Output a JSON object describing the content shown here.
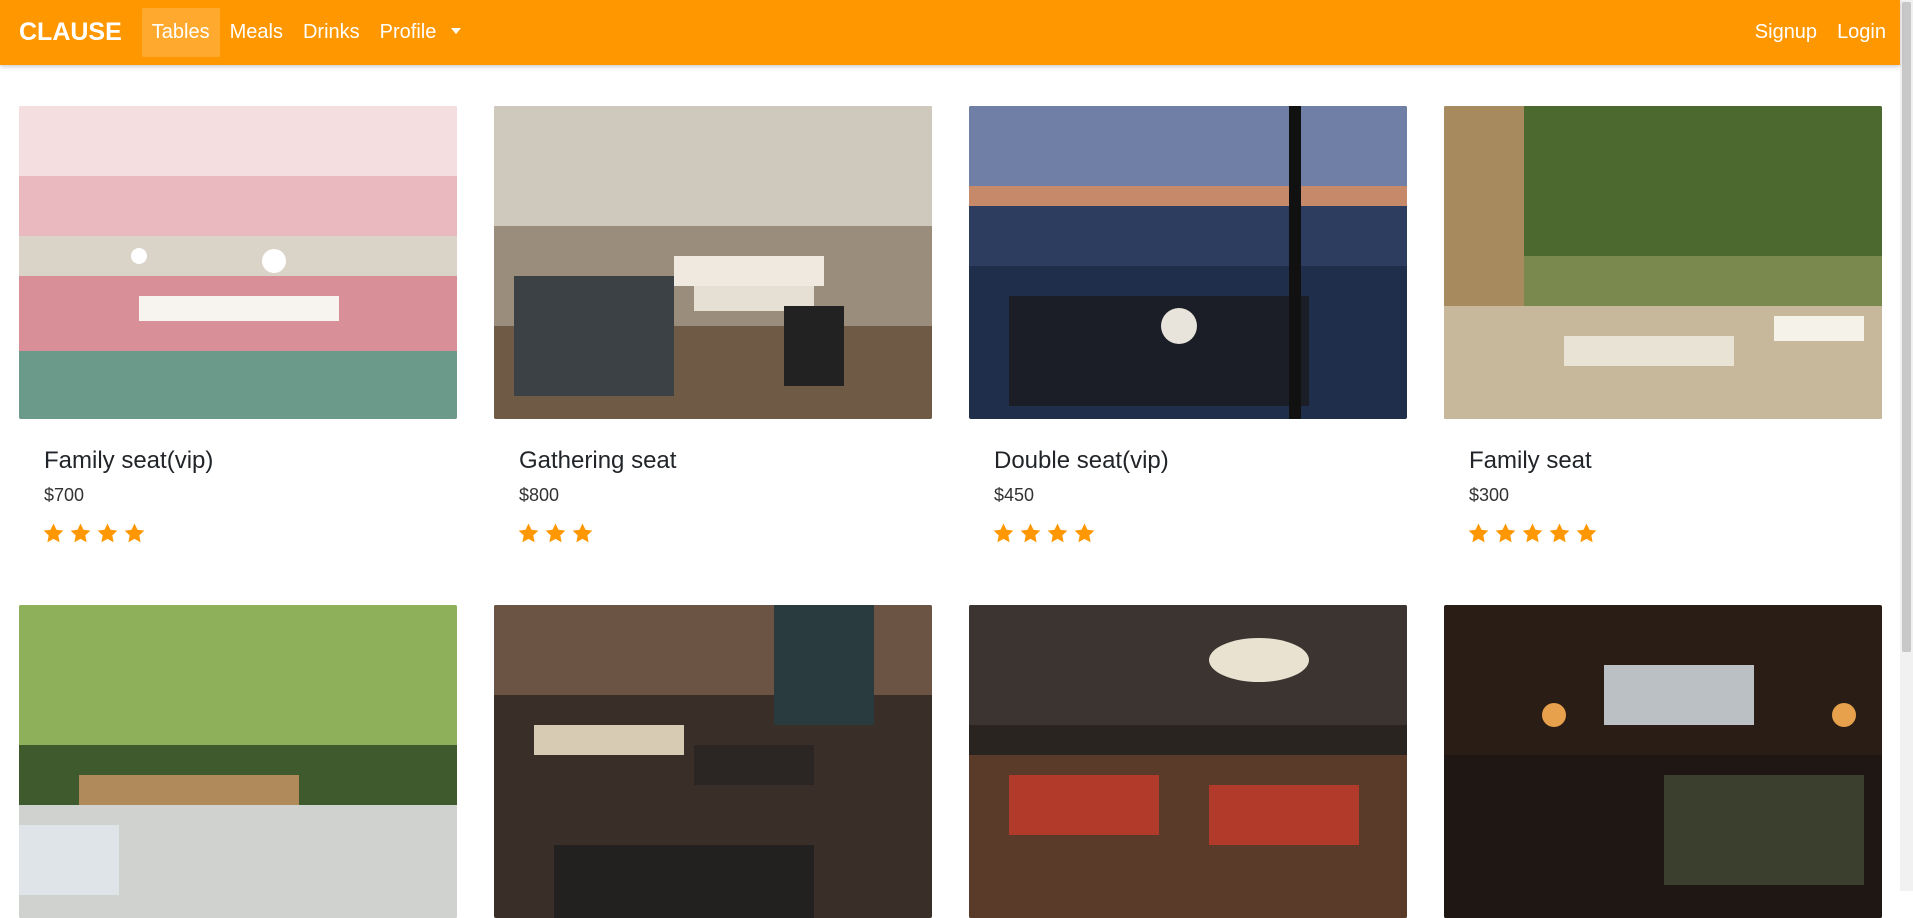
{
  "brand": "CLAUSE",
  "nav": {
    "items": [
      "Tables",
      "Meals",
      "Drinks",
      "Profile"
    ],
    "signup": "Signup",
    "login": "Login"
  },
  "colors": {
    "accent": "#ff9800",
    "star": "#ff9800"
  },
  "tables": [
    {
      "name": "Family seat(vip)",
      "price": "$700",
      "rating": 4,
      "scene": "pink-dining-room"
    },
    {
      "name": "Gathering seat",
      "price": "$800",
      "rating": 3,
      "scene": "booth-restaurant"
    },
    {
      "name": "Double seat(vip)",
      "price": "$450",
      "rating": 4,
      "scene": "rooftop-terrace"
    },
    {
      "name": "Family seat",
      "price": "$300",
      "rating": 5,
      "scene": "garden-terrace"
    },
    {
      "name": "",
      "price": "",
      "rating": 0,
      "scene": "garden-patio"
    },
    {
      "name": "",
      "price": "",
      "rating": 0,
      "scene": "dark-cafe"
    },
    {
      "name": "",
      "price": "",
      "rating": 0,
      "scene": "chandelier-restaurant"
    },
    {
      "name": "",
      "price": "",
      "rating": 0,
      "scene": "leather-lounge"
    }
  ]
}
